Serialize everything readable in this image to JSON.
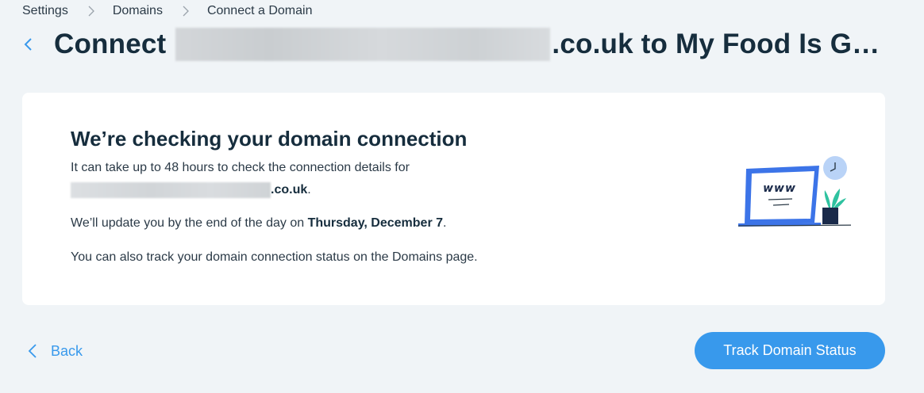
{
  "breadcrumb": {
    "items": [
      "Settings",
      "Domains",
      "Connect a Domain"
    ]
  },
  "header": {
    "title_prefix": "Connect",
    "title_suffix": ".co.uk to My Food Is G…"
  },
  "card": {
    "title": "We’re checking your domain connection",
    "line1": "It can take up to 48 hours to check the connection details for",
    "domain_suffix": ".co.uk",
    "period": ".",
    "update_prefix": "We’ll update you by the end of the day on ",
    "update_date": "Thursday, December 7",
    "update_suffix": ".",
    "track_info": "You can also track your domain connection status on the Domains page.",
    "illustration_text": "www"
  },
  "footer": {
    "back_label": "Back",
    "track_button_label": "Track Domain Status"
  },
  "colors": {
    "accent": "#3899ec",
    "background": "#f0f4f7",
    "heading": "#162d3d"
  }
}
